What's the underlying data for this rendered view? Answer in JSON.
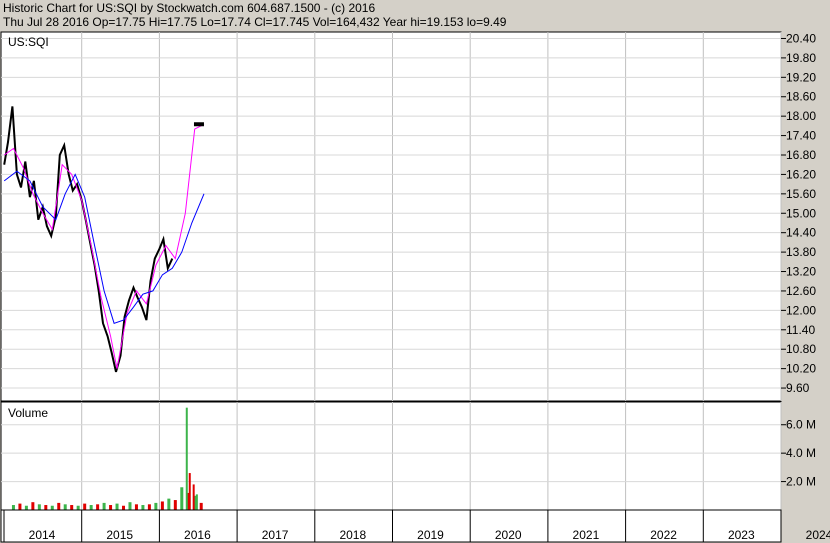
{
  "header": {
    "title": "Historic Chart for US:SQI by Stockwatch.com 604.687.1500 - (c) 2016",
    "quote": "Thu Jul 28 2016   Op=17.75   Hi=17.75   Lo=17.74   Cl=17.745   Vol=164,432   Year hi=19.153   lo=9.49"
  },
  "chart_data": [
    {
      "type": "line",
      "title": "US:SQI",
      "x_tick_labels": [
        "2014",
        "2015",
        "2016",
        "2017",
        "2018",
        "2019",
        "2020",
        "2021",
        "2022",
        "2023",
        "2024"
      ],
      "y_tick_labels": [
        "20.40",
        "19.80",
        "19.20",
        "18.60",
        "18.00",
        "17.40",
        "16.80",
        "16.20",
        "15.60",
        "15.00",
        "14.40",
        "13.80",
        "13.20",
        "12.60",
        "12.00",
        "11.40",
        "10.80",
        "10.20",
        "9.60"
      ],
      "ylim": [
        9.2,
        20.6
      ],
      "grid": true,
      "series": [
        {
          "color": "#000000",
          "values": [
            [
              "2014-01-02",
              16.5
            ],
            [
              "2014-01-20",
              17.2
            ],
            [
              "2014-02-10",
              18.3
            ],
            [
              "2014-03-01",
              16.2
            ],
            [
              "2014-03-20",
              15.8
            ],
            [
              "2014-04-10",
              16.6
            ],
            [
              "2014-05-01",
              15.5
            ],
            [
              "2014-05-20",
              16.0
            ],
            [
              "2014-06-10",
              14.8
            ],
            [
              "2014-07-01",
              15.2
            ],
            [
              "2014-07-20",
              14.6
            ],
            [
              "2014-08-10",
              14.3
            ],
            [
              "2014-09-01",
              14.9
            ],
            [
              "2014-09-20",
              16.8
            ],
            [
              "2014-10-10",
              17.1
            ],
            [
              "2014-11-01",
              16.2
            ],
            [
              "2014-11-20",
              15.7
            ],
            [
              "2014-12-10",
              15.9
            ],
            [
              "2015-01-01",
              15.4
            ],
            [
              "2015-01-20",
              14.8
            ],
            [
              "2015-02-10",
              14.1
            ],
            [
              "2015-03-01",
              13.4
            ],
            [
              "2015-03-20",
              12.6
            ],
            [
              "2015-04-10",
              11.6
            ],
            [
              "2015-05-01",
              11.2
            ],
            [
              "2015-05-20",
              10.7
            ],
            [
              "2015-06-10",
              10.1
            ],
            [
              "2015-07-01",
              10.6
            ],
            [
              "2015-07-20",
              11.8
            ],
            [
              "2015-08-10",
              12.3
            ],
            [
              "2015-09-01",
              12.7
            ],
            [
              "2015-09-20",
              12.4
            ],
            [
              "2015-10-10",
              12.1
            ],
            [
              "2015-11-01",
              11.7
            ],
            [
              "2015-11-20",
              12.9
            ],
            [
              "2015-12-10",
              13.6
            ],
            [
              "2016-01-01",
              13.9
            ],
            [
              "2016-01-20",
              14.2
            ],
            [
              "2016-02-10",
              13.3
            ],
            [
              "2016-03-01",
              13.6
            ]
          ]
        },
        {
          "color": "#ff00ff",
          "values": [
            [
              "2014-01-02",
              16.8
            ],
            [
              "2014-02-15",
              17.0
            ],
            [
              "2014-04-01",
              16.4
            ],
            [
              "2014-05-15",
              15.6
            ],
            [
              "2014-07-01",
              15.0
            ],
            [
              "2014-08-15",
              14.5
            ],
            [
              "2014-10-01",
              16.5
            ],
            [
              "2014-11-15",
              16.2
            ],
            [
              "2015-01-01",
              15.4
            ],
            [
              "2015-02-15",
              14.0
            ],
            [
              "2015-04-01",
              12.4
            ],
            [
              "2015-05-15",
              11.2
            ],
            [
              "2015-06-15",
              10.2
            ],
            [
              "2015-08-01",
              11.9
            ],
            [
              "2015-09-15",
              12.6
            ],
            [
              "2015-11-01",
              12.2
            ],
            [
              "2015-12-15",
              13.4
            ],
            [
              "2016-02-01",
              14.0
            ],
            [
              "2016-03-15",
              13.6
            ],
            [
              "2016-05-01",
              15.0
            ],
            [
              "2016-06-15",
              17.6
            ],
            [
              "2016-07-28",
              17.75
            ]
          ]
        },
        {
          "color": "#0000ff",
          "values": [
            [
              "2014-01-02",
              16.0
            ],
            [
              "2014-03-01",
              16.3
            ],
            [
              "2014-05-01",
              16.0
            ],
            [
              "2014-07-01",
              15.2
            ],
            [
              "2014-09-01",
              14.8
            ],
            [
              "2014-10-15",
              15.6
            ],
            [
              "2014-12-01",
              16.2
            ],
            [
              "2015-01-15",
              15.5
            ],
            [
              "2015-03-01",
              14.0
            ],
            [
              "2015-04-15",
              12.6
            ],
            [
              "2015-06-01",
              11.6
            ],
            [
              "2015-07-15",
              11.7
            ],
            [
              "2015-09-01",
              12.1
            ],
            [
              "2015-10-15",
              12.5
            ],
            [
              "2015-12-01",
              12.6
            ],
            [
              "2016-01-15",
              13.1
            ],
            [
              "2016-03-01",
              13.3
            ],
            [
              "2016-04-15",
              13.8
            ],
            [
              "2016-06-01",
              14.7
            ],
            [
              "2016-07-28",
              15.6
            ]
          ]
        }
      ]
    },
    {
      "type": "bar",
      "title": "Volume",
      "y_tick_labels": [
        "6.0 M",
        "4.0 M",
        "2.0 M"
      ],
      "ylim": [
        0,
        7.6
      ],
      "unit": "M",
      "values": [
        [
          "2014-02",
          0.35
        ],
        [
          "2014-03",
          0.45
        ],
        [
          "2014-04",
          0.3
        ],
        [
          "2014-05",
          0.55
        ],
        [
          "2014-06",
          0.4
        ],
        [
          "2014-07",
          0.35
        ],
        [
          "2014-08",
          0.3
        ],
        [
          "2014-09",
          0.5
        ],
        [
          "2014-10",
          0.4
        ],
        [
          "2014-11",
          0.35
        ],
        [
          "2014-12",
          0.3
        ],
        [
          "2015-01",
          0.45
        ],
        [
          "2015-02",
          0.35
        ],
        [
          "2015-03",
          0.4
        ],
        [
          "2015-04",
          0.5
        ],
        [
          "2015-05",
          0.35
        ],
        [
          "2015-06",
          0.45
        ],
        [
          "2015-07",
          0.3
        ],
        [
          "2015-08",
          0.55
        ],
        [
          "2015-09",
          0.4
        ],
        [
          "2015-10",
          0.35
        ],
        [
          "2015-11",
          0.4
        ],
        [
          "2015-12",
          0.5
        ],
        [
          "2016-01",
          0.6
        ],
        [
          "2016-02",
          0.8
        ],
        [
          "2016-03",
          0.7
        ],
        [
          "2016-04",
          1.6
        ],
        [
          "2016-05",
          1.2
        ],
        [
          "2016-06",
          1.0
        ],
        [
          "2016-07",
          0.5
        ]
      ],
      "spikes": [
        {
          "date": "2016-05-08",
          "value": 7.2,
          "color": "#3cb44b"
        },
        {
          "date": "2016-05-22",
          "value": 2.6,
          "color": "#e00000"
        },
        {
          "date": "2016-06-10",
          "value": 1.8,
          "color": "#e00000"
        },
        {
          "date": "2016-06-25",
          "value": 1.1,
          "color": "#3cb44b"
        }
      ]
    }
  ]
}
